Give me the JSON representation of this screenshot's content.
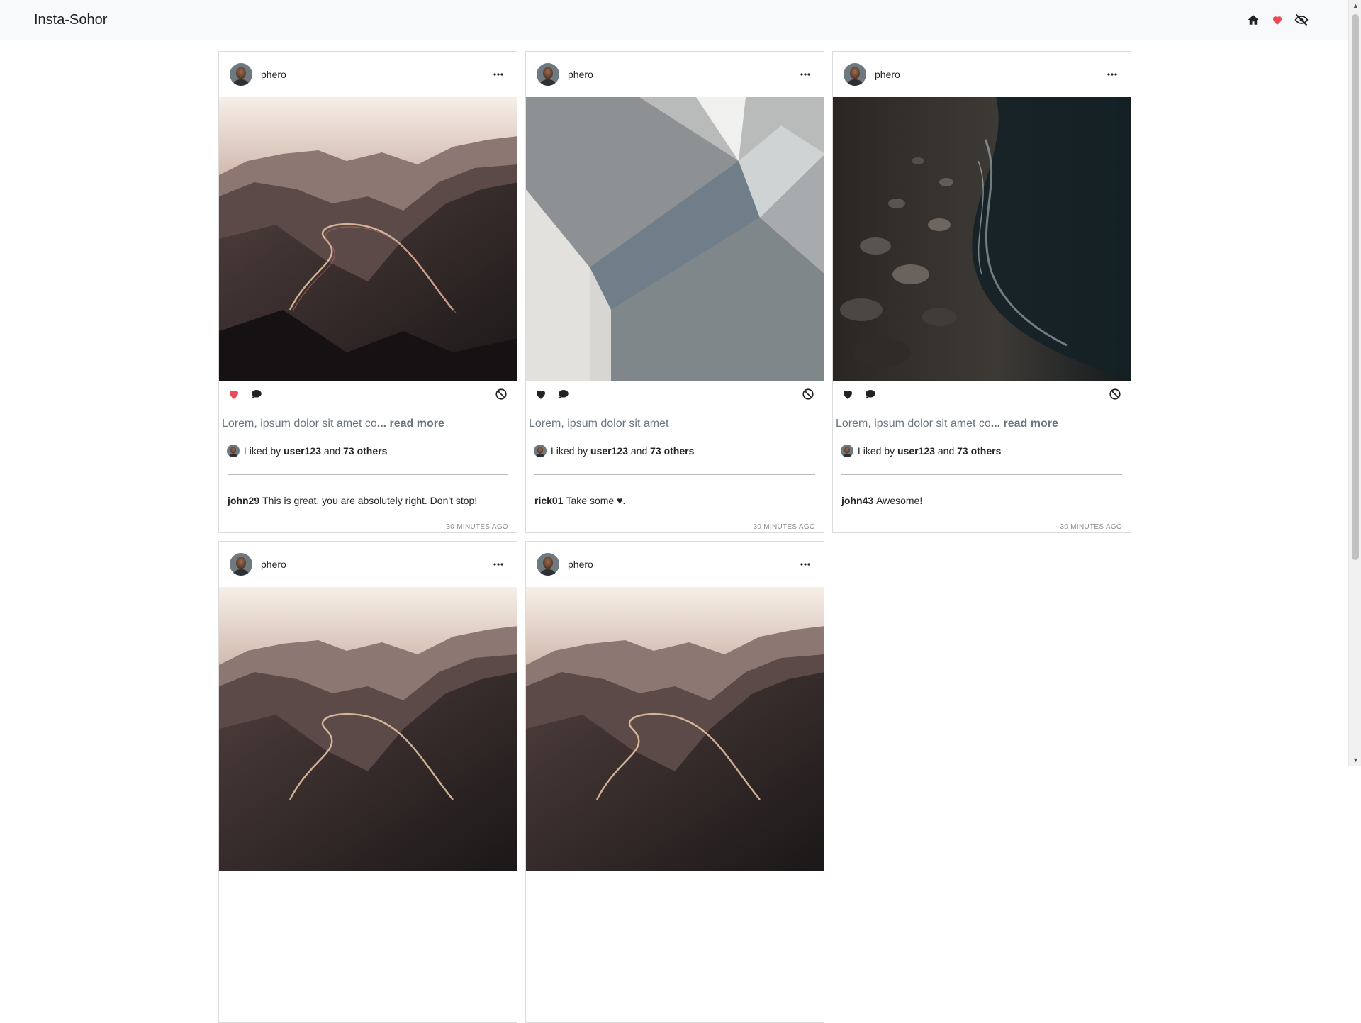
{
  "app": {
    "title": "Insta-Sohor"
  },
  "nav": {
    "icons": [
      "home-icon",
      "heart-icon",
      "eye-slash-icon"
    ],
    "accent": "#ed4956"
  },
  "posts": [
    {
      "username": "phero",
      "image": "mountain-road",
      "liked": true,
      "caption": "Lorem, ipsum dolor sit amet co",
      "ellipsis": "... ",
      "read_more": "read more",
      "likes": {
        "prefix": "Liked by",
        "user": "user123",
        "and": "and",
        "others": "73 others"
      },
      "comment": {
        "user": "john29",
        "text": "This is great. you are absolutely right. Don't stop!"
      },
      "time": "30 MINUTES AGO"
    },
    {
      "username": "phero",
      "image": "grey-geometry",
      "liked": false,
      "caption": "Lorem, ipsum dolor sit amet",
      "ellipsis": "",
      "read_more": "",
      "likes": {
        "prefix": "Liked by",
        "user": "user123",
        "and": "and",
        "others": "73 others"
      },
      "comment": {
        "user": "rick01",
        "text": "Take some ",
        "emoji": "♥",
        "tail": "."
      },
      "time": "30 MINUTES AGO"
    },
    {
      "username": "phero",
      "image": "pebble-shore",
      "liked": false,
      "caption": "Lorem, ipsum dolor sit amet co",
      "ellipsis": "... ",
      "read_more": "read more",
      "likes": {
        "prefix": "Liked by",
        "user": "user123",
        "and": "and",
        "others": "73 others"
      },
      "comment": {
        "user": "john43",
        "text": "Awesome!"
      },
      "time": "30 MINUTES AGO"
    },
    {
      "username": "phero",
      "image": "mountain-road"
    },
    {
      "username": "phero",
      "image": "mountain-road"
    }
  ]
}
